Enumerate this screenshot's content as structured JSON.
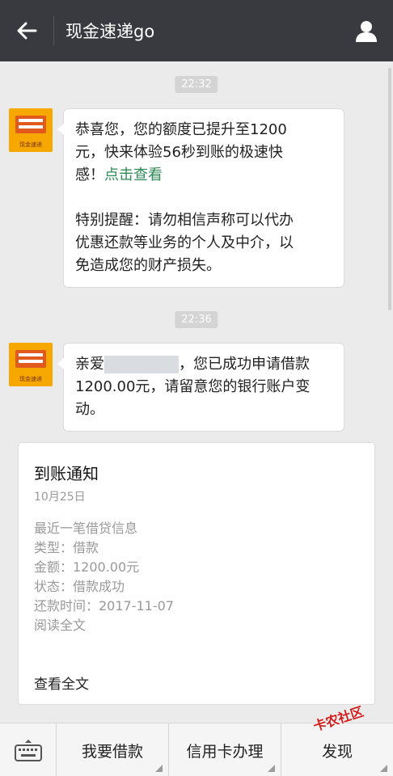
{
  "header": {
    "title": "现金速递go"
  },
  "messages": [
    {
      "time": "22:32",
      "lines": [
        "恭喜您，您的额度已提升至1200",
        "元，快来体验56秒到账的极速快",
        "感！"
      ],
      "link": "点击查看",
      "reminder": [
        "特别提醒：请勿相信声称可以代办",
        "优惠还款等业务的个人及中介，以",
        "免造成您的财产损失。"
      ]
    },
    {
      "time": "22:36",
      "prefix": "亲爱",
      "suffix": "，您已成功申请借款",
      "lines": [
        "1200.00元，请留意您的银行账户变",
        "动。"
      ]
    }
  ],
  "card": {
    "title": "到账通知",
    "date": "10月25日",
    "lines": [
      "最近一笔借贷信息",
      "类型：借款",
      "金额：1200.00元",
      "状态：借款成功",
      "还款时间：2017-11-07",
      "阅读全文"
    ],
    "footer": "查看全文"
  },
  "avatar": {
    "caption": "现金速递"
  },
  "bottom_menu": [
    "我要借款",
    "信用卡办理",
    "发现"
  ],
  "watermark": "卡农社区",
  "colors": {
    "topbar": "#393a3f",
    "avatar_bg": "#f7a800",
    "link": "#2e8b57"
  }
}
